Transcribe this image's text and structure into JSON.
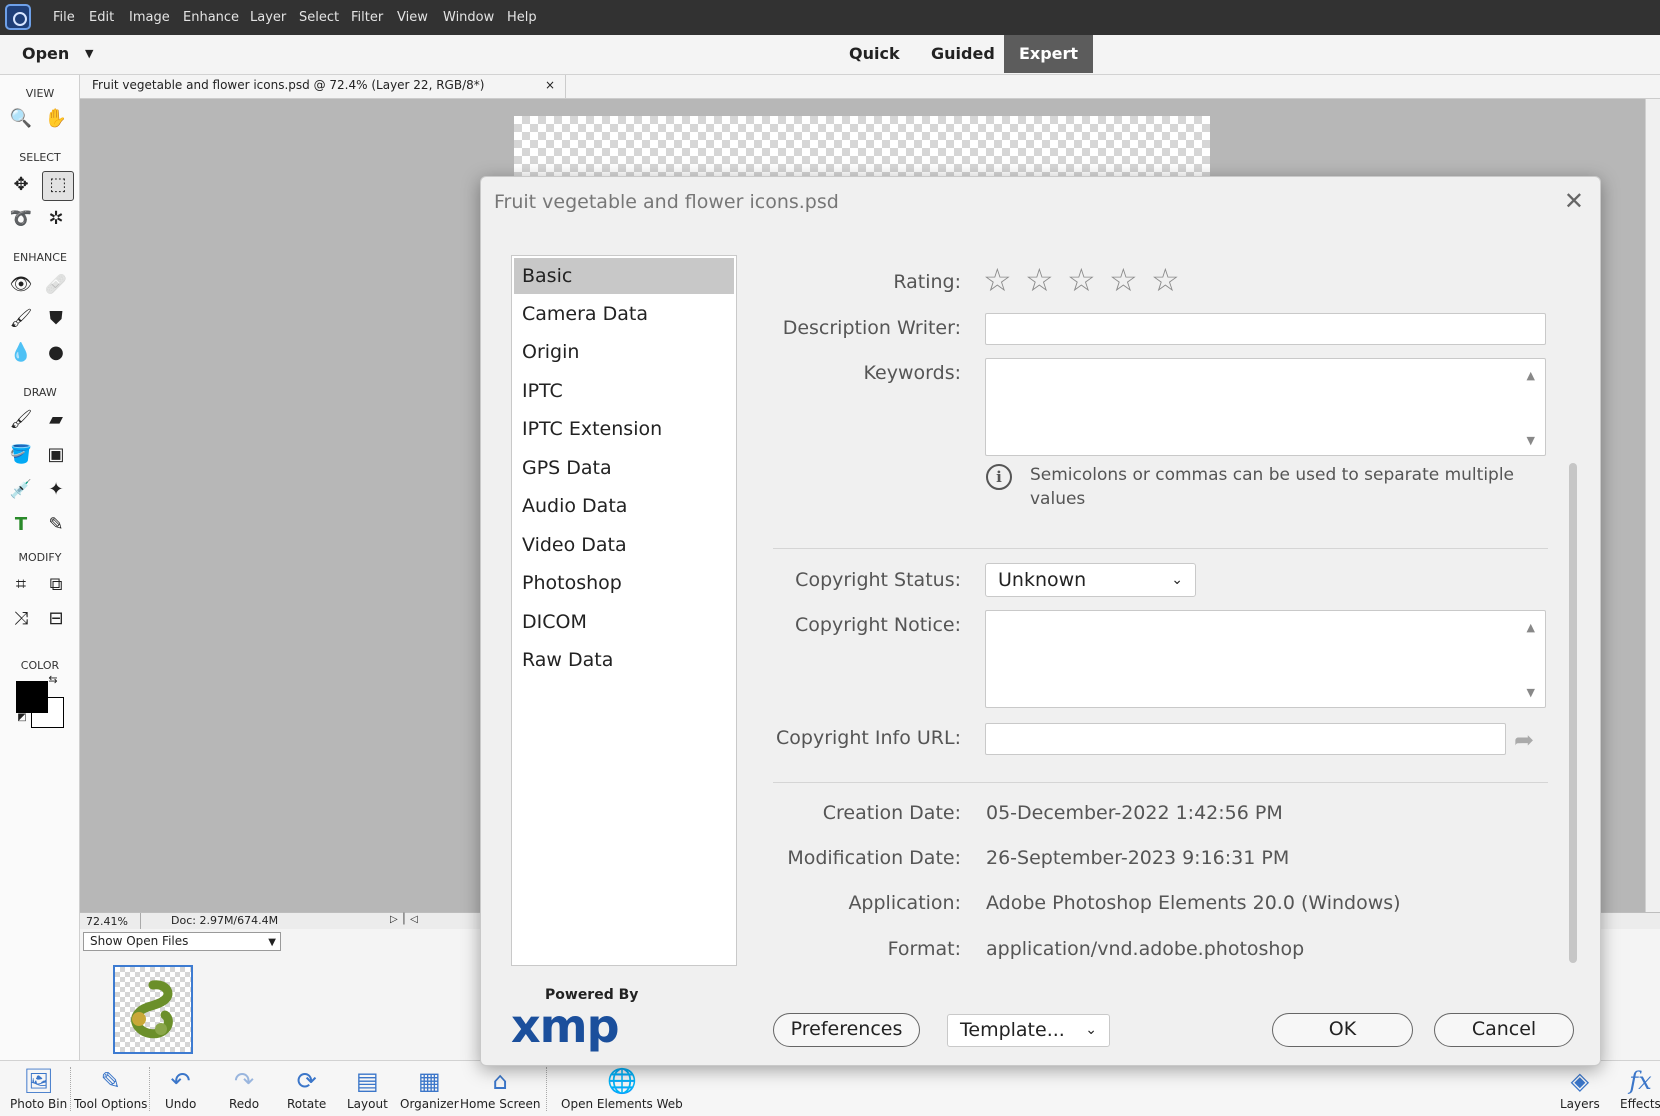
{
  "menubar": {
    "items": [
      "File",
      "Edit",
      "Image",
      "Enhance",
      "Layer",
      "Select",
      "Filter",
      "View",
      "Window",
      "Help"
    ]
  },
  "modebar": {
    "open_label": "Open",
    "modes": [
      "Quick",
      "Guided",
      "Expert"
    ],
    "active_mode": "Expert"
  },
  "toolbox": {
    "sections": [
      "VIEW",
      "SELECT",
      "ENHANCE",
      "DRAW",
      "MODIFY",
      "COLOR"
    ],
    "foreground_color": "#000000",
    "background_color": "#ffffff"
  },
  "document": {
    "tab_title": "Fruit vegetable and flower icons.psd @ 72.4% (Layer 22, RGB/8*)",
    "close_glyph": "×",
    "zoom": "72.41%",
    "doc_size": "Doc: 2.97M/674.4M"
  },
  "photobin": {
    "select_value": "Show Open Files"
  },
  "taskbar": {
    "buttons": [
      "Photo Bin",
      "Tool Options",
      "Undo",
      "Redo",
      "Rotate",
      "Layout",
      "Organizer",
      "Home Screen",
      "Open Elements Web"
    ],
    "right_buttons": [
      "Layers",
      "Effects"
    ]
  },
  "dialog": {
    "title": "Fruit vegetable and flower icons.psd",
    "close_glyph": "✕",
    "nav": {
      "items": [
        "Basic",
        "Camera Data",
        "Origin",
        "IPTC",
        "IPTC Extension",
        "GPS Data",
        "Audio Data",
        "Video Data",
        "Photoshop",
        "DICOM",
        "Raw Data"
      ],
      "selected": "Basic"
    },
    "fields": {
      "rating_label": "Rating:",
      "rating_value": 0,
      "rating_max": 5,
      "description_writer_label": "Description Writer:",
      "description_writer_value": "",
      "keywords_label": "Keywords:",
      "keywords_value": "",
      "keywords_hint": "Semicolons or commas can be used to separate multiple values",
      "copyright_status_label": "Copyright Status:",
      "copyright_status_value": "Unknown",
      "copyright_notice_label": "Copyright Notice:",
      "copyright_notice_value": "",
      "copyright_url_label": "Copyright Info URL:",
      "copyright_url_value": "",
      "creation_date_label": "Creation Date:",
      "creation_date_value": "05-December-2022 1:42:56 PM",
      "modification_date_label": "Modification Date:",
      "modification_date_value": "26-September-2023 9:16:31 PM",
      "application_label": "Application:",
      "application_value": "Adobe Photoshop Elements 20.0 (Windows)",
      "format_label": "Format:",
      "format_value": "application/vnd.adobe.photoshop"
    },
    "footer": {
      "powered_by": "Powered By",
      "xmp_logo": "xmp",
      "preferences_label": "Preferences",
      "template_label": "Template...",
      "ok_label": "OK",
      "cancel_label": "Cancel"
    }
  },
  "colors": {
    "menubar_bg": "#323232",
    "active_mode_bg": "#5c5c5c",
    "accent_blue": "#3b76c9",
    "xmp_blue": "#1b4f9c"
  }
}
